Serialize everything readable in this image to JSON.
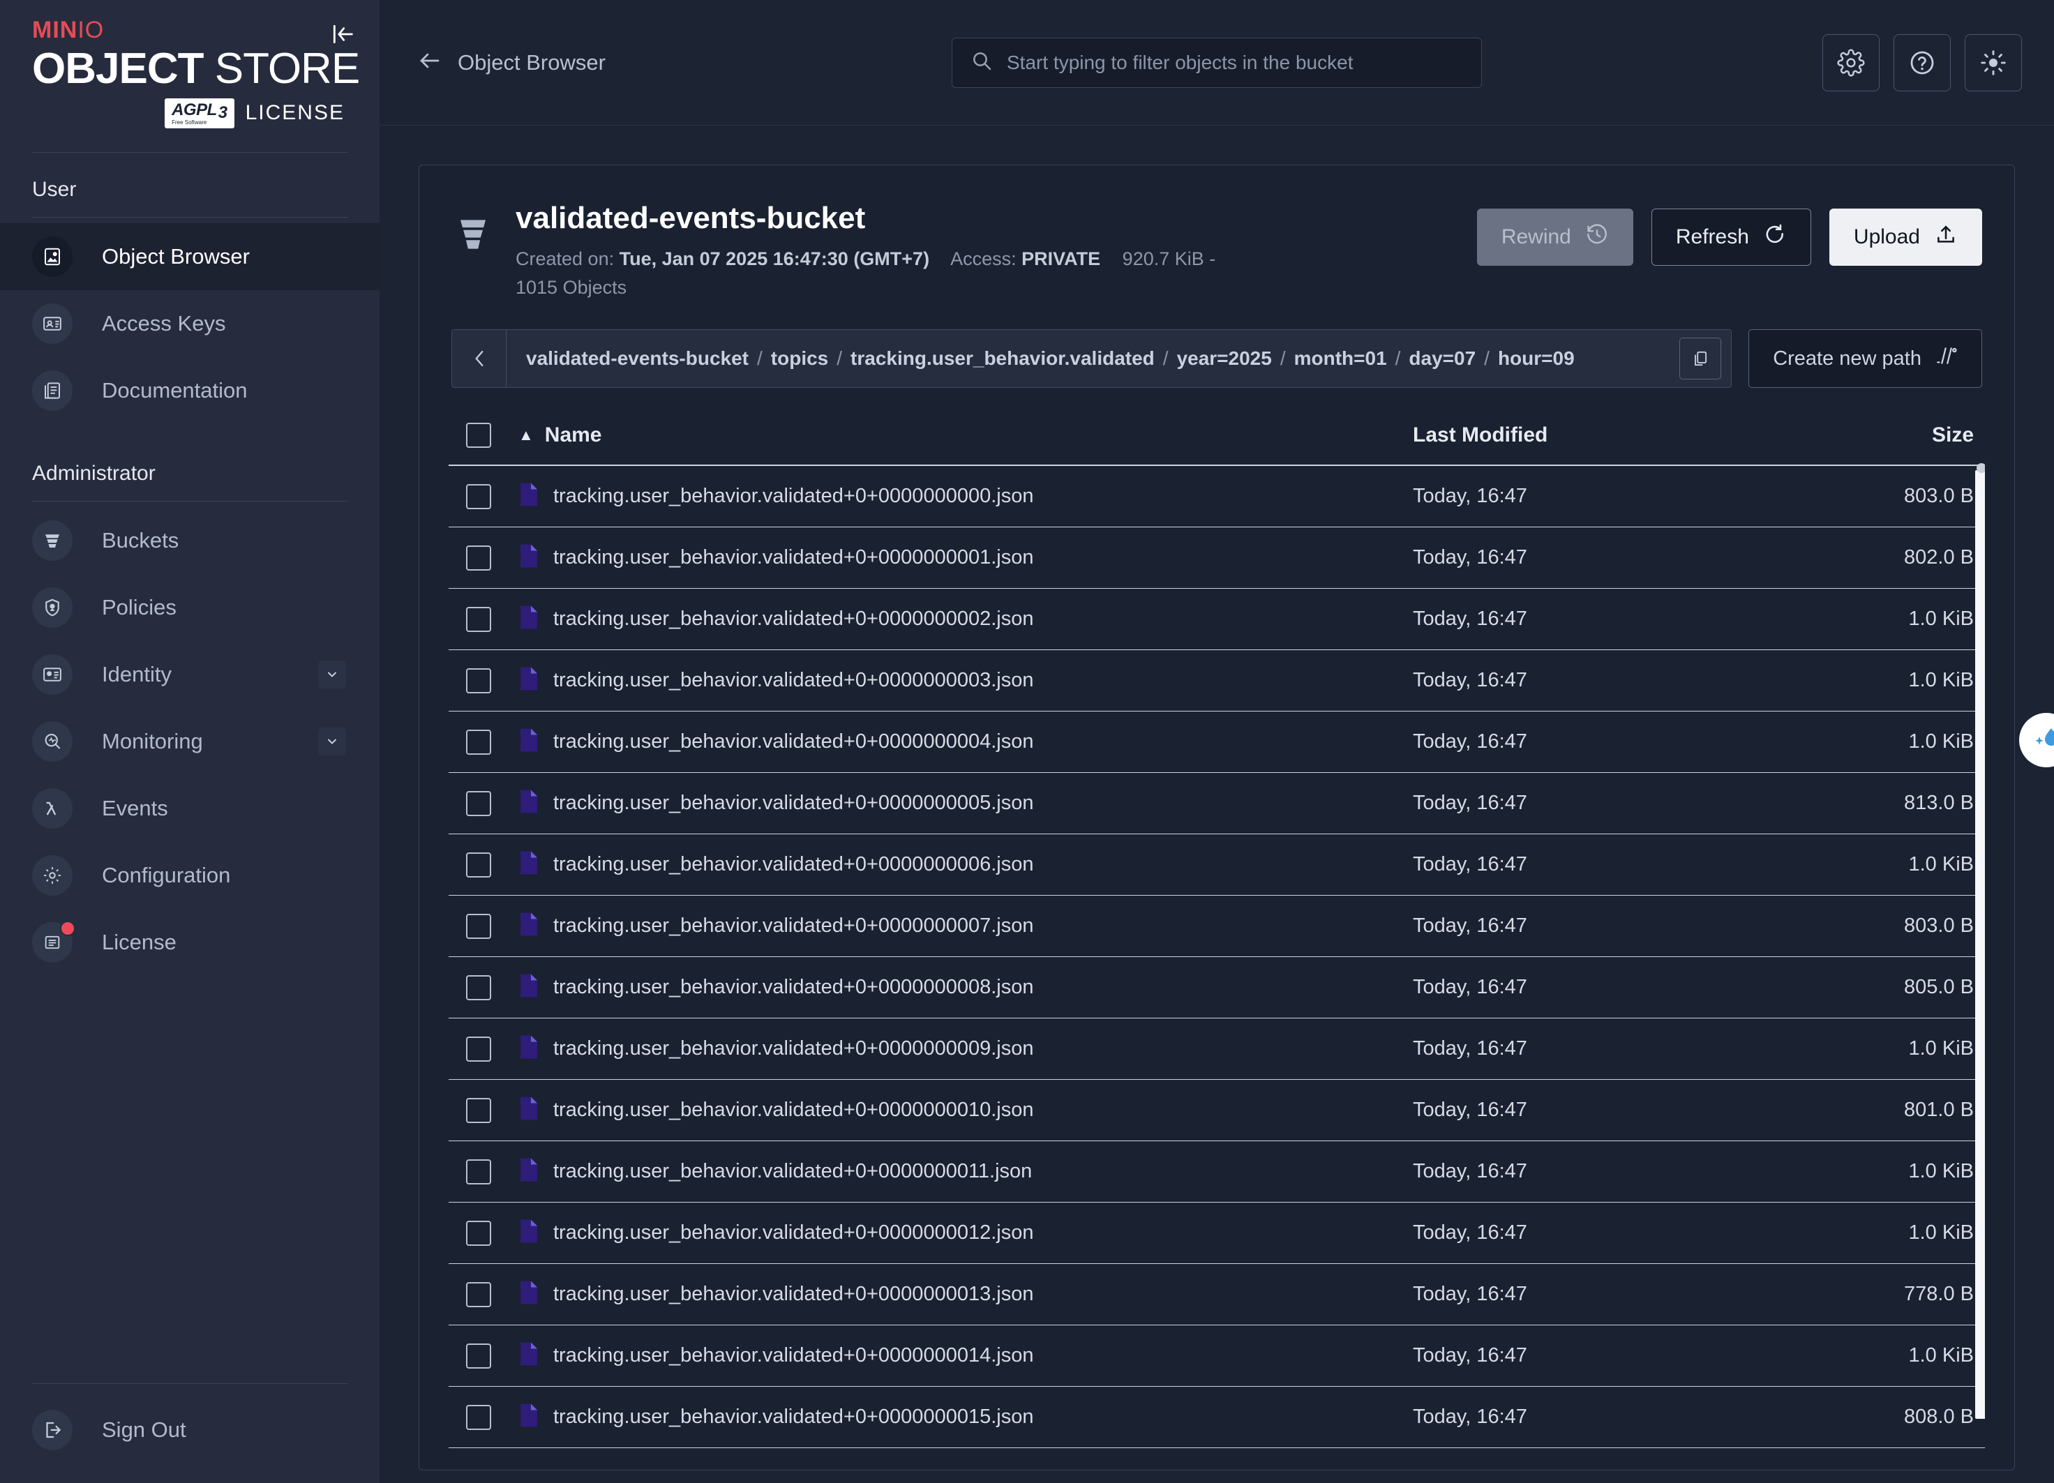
{
  "sidebar": {
    "logo": {
      "brand": "MIN",
      "brand_suffix": "IO",
      "title_bold": "OBJECT",
      "title_light": "STORE",
      "agpl": "AGPL",
      "agpl_sub": "Free Software",
      "agpl_version": "3",
      "license_word": "LICENSE"
    },
    "collapse_label": "collapse-sidebar",
    "user_section": "User",
    "user_items": [
      {
        "label": "Object Browser",
        "icon": "object-browser-icon",
        "active": true
      },
      {
        "label": "Access Keys",
        "icon": "access-keys-icon",
        "active": false
      },
      {
        "label": "Documentation",
        "icon": "documentation-icon",
        "active": false
      }
    ],
    "admin_section": "Administrator",
    "admin_items": [
      {
        "label": "Buckets",
        "icon": "buckets-icon",
        "chevron": false,
        "badge": false
      },
      {
        "label": "Policies",
        "icon": "policies-icon",
        "chevron": false,
        "badge": false
      },
      {
        "label": "Identity",
        "icon": "identity-icon",
        "chevron": true,
        "badge": false
      },
      {
        "label": "Monitoring",
        "icon": "monitoring-icon",
        "chevron": true,
        "badge": false
      },
      {
        "label": "Events",
        "icon": "events-lambda-icon",
        "chevron": false,
        "badge": false
      },
      {
        "label": "Configuration",
        "icon": "configuration-gear-icon",
        "chevron": false,
        "badge": false
      },
      {
        "label": "License",
        "icon": "license-icon",
        "chevron": false,
        "badge": true
      }
    ],
    "sign_out": {
      "label": "Sign Out",
      "icon": "sign-out-icon"
    }
  },
  "topbar": {
    "back_label": "Object Browser",
    "back_icon": "arrow-left-icon",
    "search_placeholder": "Start typing to filter objects in the bucket",
    "search_value": "",
    "search_icon": "search-icon",
    "actions": [
      {
        "name": "settings-button",
        "icon": "gear-icon"
      },
      {
        "name": "help-button",
        "icon": "question-circle-icon"
      },
      {
        "name": "theme-toggle-button",
        "icon": "sun-icon"
      }
    ]
  },
  "bucket": {
    "name": "validated-events-bucket",
    "created_label": "Created on:",
    "created_value": "Tue, Jan 07 2025 16:47:30 (GMT+7)",
    "access_label": "Access:",
    "access_value": "PRIVATE",
    "size": "920.7 KiB -",
    "objects": "1015 Objects",
    "icon": "bucket-icon",
    "buttons": [
      {
        "label": "Rewind",
        "icon": "rewind-clock-icon",
        "style": "rewind"
      },
      {
        "label": "Refresh",
        "icon": "refresh-icon",
        "style": "refresh"
      },
      {
        "label": "Upload",
        "icon": "upload-icon",
        "style": "upload"
      }
    ]
  },
  "breadcrumb": {
    "back_icon": "chevron-left-icon",
    "segments": [
      "validated-events-bucket",
      "topics",
      "tracking.user_behavior.validated",
      "year=2025",
      "month=01",
      "day=07",
      "hour=09"
    ],
    "separator": "/",
    "copy_icon": "copy-icon",
    "create_path_label": "Create new path",
    "create_path_icon": "new-path-icon"
  },
  "table": {
    "headers": {
      "name": "Name",
      "last_modified": "Last Modified",
      "size": "Size"
    },
    "sort_indicator": "▲",
    "rows": [
      {
        "name": "tracking.user_behavior.validated+0+0000000000.json",
        "modified": "Today, 16:47",
        "size": "803.0 B"
      },
      {
        "name": "tracking.user_behavior.validated+0+0000000001.json",
        "modified": "Today, 16:47",
        "size": "802.0 B"
      },
      {
        "name": "tracking.user_behavior.validated+0+0000000002.json",
        "modified": "Today, 16:47",
        "size": "1.0 KiB"
      },
      {
        "name": "tracking.user_behavior.validated+0+0000000003.json",
        "modified": "Today, 16:47",
        "size": "1.0 KiB"
      },
      {
        "name": "tracking.user_behavior.validated+0+0000000004.json",
        "modified": "Today, 16:47",
        "size": "1.0 KiB"
      },
      {
        "name": "tracking.user_behavior.validated+0+0000000005.json",
        "modified": "Today, 16:47",
        "size": "813.0 B"
      },
      {
        "name": "tracking.user_behavior.validated+0+0000000006.json",
        "modified": "Today, 16:47",
        "size": "1.0 KiB"
      },
      {
        "name": "tracking.user_behavior.validated+0+0000000007.json",
        "modified": "Today, 16:47",
        "size": "803.0 B"
      },
      {
        "name": "tracking.user_behavior.validated+0+0000000008.json",
        "modified": "Today, 16:47",
        "size": "805.0 B"
      },
      {
        "name": "tracking.user_behavior.validated+0+0000000009.json",
        "modified": "Today, 16:47",
        "size": "1.0 KiB"
      },
      {
        "name": "tracking.user_behavior.validated+0+0000000010.json",
        "modified": "Today, 16:47",
        "size": "801.0 B"
      },
      {
        "name": "tracking.user_behavior.validated+0+0000000011.json",
        "modified": "Today, 16:47",
        "size": "1.0 KiB"
      },
      {
        "name": "tracking.user_behavior.validated+0+0000000012.json",
        "modified": "Today, 16:47",
        "size": "1.0 KiB"
      },
      {
        "name": "tracking.user_behavior.validated+0+0000000013.json",
        "modified": "Today, 16:47",
        "size": "778.0 B"
      },
      {
        "name": "tracking.user_behavior.validated+0+0000000014.json",
        "modified": "Today, 16:47",
        "size": "1.0 KiB"
      },
      {
        "name": "tracking.user_behavior.validated+0+0000000015.json",
        "modified": "Today, 16:47",
        "size": "808.0 B"
      }
    ]
  },
  "floating": {
    "icon": "water-drop-sparkle-icon"
  },
  "colors": {
    "accent_red": "#e64b55",
    "sidebar_bg": "#262c3d",
    "main_bg": "#1c2333",
    "panel_bg": "#1a2130",
    "file_icon": "#2e1d7a",
    "badge_red": "#ef4a5c",
    "upload_bg": "#eef0f3"
  }
}
